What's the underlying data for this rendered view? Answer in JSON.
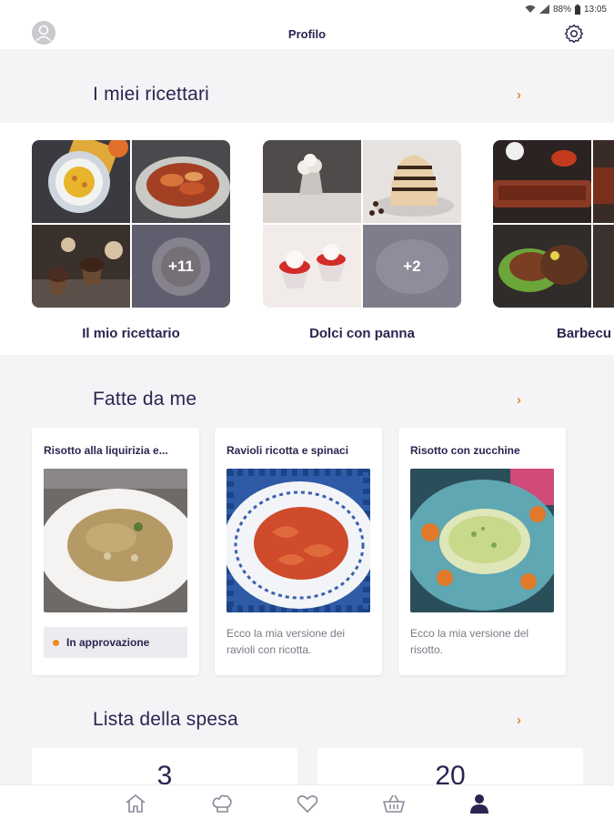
{
  "status_bar": {
    "battery": "88%",
    "time": "13:05"
  },
  "header": {
    "title": "Profilo"
  },
  "sections": {
    "cookbooks": {
      "title": "I miei ricettari"
    },
    "made_by_me": {
      "title": "Fatte da me"
    },
    "shopping": {
      "title": "Lista della spesa"
    }
  },
  "cookbooks": [
    {
      "title": "Il mio ricettario",
      "more": "+11"
    },
    {
      "title": "Dolci con panna",
      "more": "+2"
    },
    {
      "title": "Barbecu"
    }
  ],
  "made_by_me": [
    {
      "title": "Risotto alla liquirizia e...",
      "status": "In approvazione"
    },
    {
      "title": "Ravioli ricotta e spinaci",
      "description": "Ecco la mia versione dei ravioli con ricotta."
    },
    {
      "title": "Risotto con zucchine",
      "description": "Ecco la mia versione del risotto."
    }
  ],
  "shopping": {
    "counts": [
      "3",
      "20"
    ]
  },
  "colors": {
    "accent": "#f08a1c",
    "primary_text": "#2a2550",
    "background": "#f4f4f7"
  },
  "icons": [
    "wifi-icon",
    "signal-icon",
    "battery-icon",
    "avatar-icon",
    "gear-icon",
    "chevron-right-icon",
    "home-icon",
    "chef-hat-icon",
    "heart-icon",
    "basket-icon",
    "profile-icon"
  ]
}
